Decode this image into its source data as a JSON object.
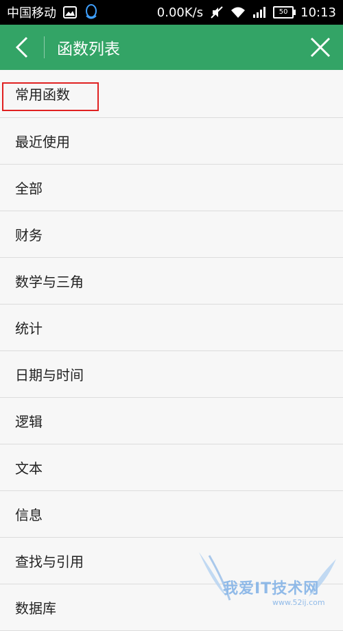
{
  "status_bar": {
    "carrier": "中国移动",
    "speed": "0.00K/s",
    "battery": "50",
    "time": "10:13"
  },
  "header": {
    "title": "函数列表"
  },
  "list": {
    "items": [
      {
        "label": "常用函数"
      },
      {
        "label": "最近使用"
      },
      {
        "label": "全部"
      },
      {
        "label": "财务"
      },
      {
        "label": "数学与三角"
      },
      {
        "label": "统计"
      },
      {
        "label": "日期与时间"
      },
      {
        "label": "逻辑"
      },
      {
        "label": "文本"
      },
      {
        "label": "信息"
      },
      {
        "label": "查找与引用"
      },
      {
        "label": "数据库"
      }
    ]
  },
  "watermark": {
    "text": "我爱IT技术网",
    "url": "www.52ij.com"
  },
  "colors": {
    "header_bg": "#33a466",
    "highlight": "#e02020"
  }
}
